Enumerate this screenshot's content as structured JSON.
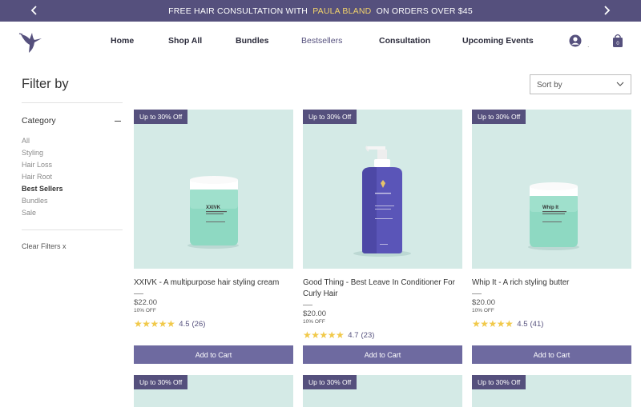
{
  "announcement": {
    "text_before": "FREE HAIR CONSULTATION WITH",
    "highlight": "PAULA BLAND",
    "text_after": "ON ORDERS OVER $45"
  },
  "nav": {
    "items": [
      "Home",
      "Shop All",
      "Bundles",
      "Bestsellers",
      "Consultation",
      "Upcoming Events"
    ],
    "active": "Bestsellers"
  },
  "filters": {
    "title": "Filter by",
    "category_label": "Category",
    "categories": [
      "All",
      "Styling",
      "Hair Loss",
      "Hair Root",
      "Best Sellers",
      "Bundles",
      "Sale"
    ],
    "selected": "Best Sellers",
    "clear_label": "Clear Filters",
    "clear_x": "x"
  },
  "sort": {
    "label": "Sort by"
  },
  "products": [
    {
      "badge": "Up to 30% Off",
      "name": "XXIVK - A multipurpose hair styling cream",
      "price": "$22.00",
      "discount": "10% OFF",
      "rating": "4.5",
      "reviews": "(26)",
      "button": "Add to Cart",
      "jar_label": "XXIVK"
    },
    {
      "badge": "Up to 30% Off",
      "name": "Good Thing - Best Leave In Conditioner For Curly Hair",
      "price": "$20.00",
      "discount": "10% OFF",
      "rating": "4.7",
      "reviews": "(23)",
      "button": "Add to Cart",
      "jar_label": "Good Thing"
    },
    {
      "badge": "Up to 30% Off",
      "name": "Whip It - A rich styling butter",
      "price": "$20.00",
      "discount": "10% OFF",
      "rating": "4.5",
      "reviews": "(41)",
      "button": "Add to Cart",
      "jar_label": "Whip It"
    }
  ],
  "products_row2": [
    {
      "badge": "Up to 30% Off"
    },
    {
      "badge": "Up to 30% Off"
    },
    {
      "badge": "Up to 30% Off"
    }
  ],
  "colors": {
    "brand": "#55507d",
    "button": "#6e6aa0",
    "product_bg": "#d4eae6",
    "star": "#f1c94a",
    "highlight": "#f3d36b"
  },
  "icons": [
    "chevron-left-icon",
    "chevron-right-icon",
    "hummingbird-logo-icon",
    "user-icon",
    "shopping-bag-icon",
    "chevron-down-icon",
    "minus-icon"
  ]
}
